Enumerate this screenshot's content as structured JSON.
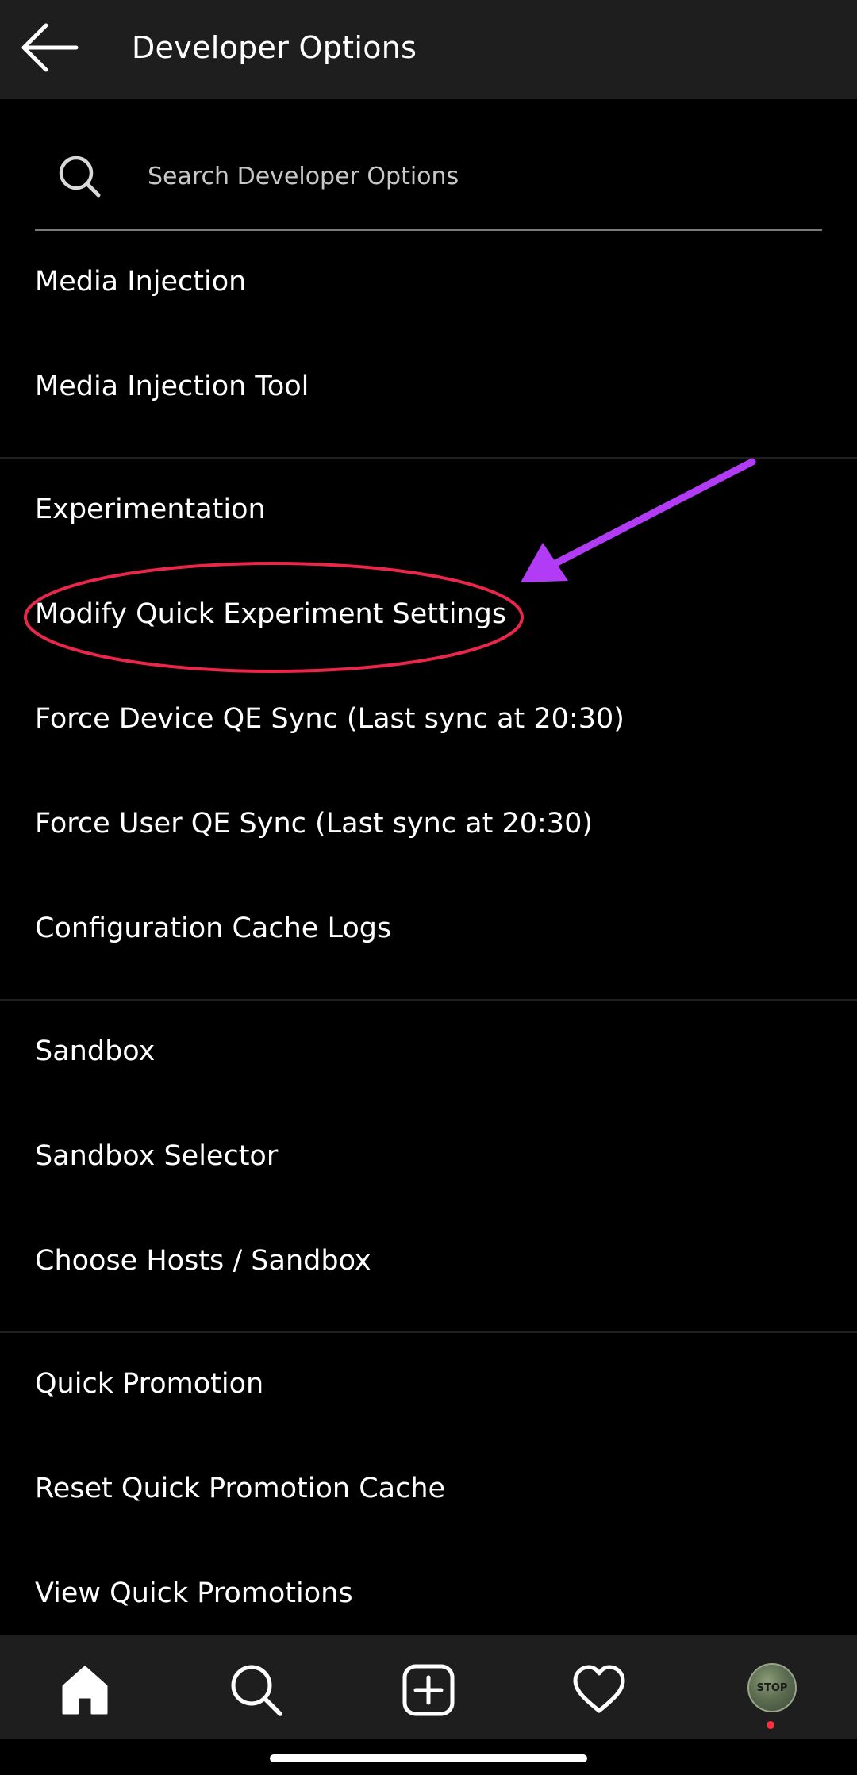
{
  "header": {
    "title": "Developer Options",
    "back_icon": "arrow-left-icon"
  },
  "search": {
    "placeholder": "Search Developer Options",
    "value": "",
    "icon": "search-icon"
  },
  "sections": [
    {
      "heading": "Media Injection",
      "items": [
        "Media Injection Tool"
      ]
    },
    {
      "heading": "Experimentation",
      "items": [
        "Modify Quick Experiment Settings",
        "Force Device QE Sync (Last sync at 20:30)",
        "Force User QE Sync (Last sync at 20:30)",
        "Configuration Cache Logs"
      ]
    },
    {
      "heading": "Sandbox",
      "items": [
        "Sandbox Selector",
        "Choose Hosts / Sandbox"
      ]
    },
    {
      "heading": "Quick Promotion",
      "items": [
        "Reset Quick Promotion Cache",
        "View Quick Promotions"
      ]
    }
  ],
  "annotations": {
    "highlight_color": "#e8274a",
    "arrow_color": "#b23bf5",
    "highlighted_item": "Modify Quick Experiment Settings"
  },
  "bottom_nav": {
    "items": [
      {
        "icon": "home-icon"
      },
      {
        "icon": "search-icon"
      },
      {
        "icon": "add-post-icon"
      },
      {
        "icon": "heart-icon"
      },
      {
        "icon": "profile-avatar"
      }
    ],
    "avatar_text": "STOP",
    "notification_dot_color": "#ff3040"
  },
  "colors": {
    "background": "#000000",
    "bar_background": "#1e1e1e",
    "text": "#ffffff",
    "placeholder": "#c8c8c8"
  }
}
